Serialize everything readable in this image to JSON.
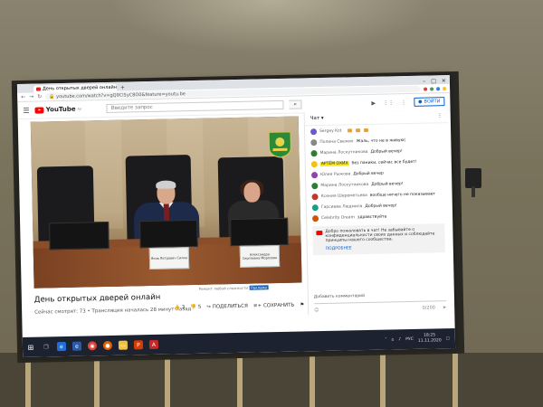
{
  "browser": {
    "tab_title": "День открытых дверей онлайн",
    "url": "youtube.com/watch?v=gQ9Cl5yC8O0&feature=youtu.be"
  },
  "youtube": {
    "logo_text": "YouTube",
    "logo_region": "RU",
    "search_placeholder": "Введите запрос",
    "signin_label": "ВОЙТИ"
  },
  "video": {
    "nameplate_left": "Яков Петрович Силин",
    "nameplate_right": "Александра Сергеевна Морозова",
    "watermark": "Ремонт любой сложности",
    "watermark_badge": "Реклама",
    "title": "День открытых дверей онлайн",
    "meta": "Сейчас смотрят: 73 • Трансляция началась 28 минут назад",
    "likes": "3",
    "dislikes": "5",
    "share_label": "ПОДЕЛИТЬСЯ",
    "save_label": "СОХРАНИТЬ"
  },
  "chat": {
    "header": "Чат",
    "messages": [
      {
        "author": "Sergey Kot",
        "text": "",
        "avatar_color": "#6a5acd",
        "highlight": false,
        "emoji": true
      },
      {
        "author": "Полина Свежих",
        "text": "Жаль, что не в живую(",
        "avatar_color": "#888888",
        "highlight": false,
        "emoji": false
      },
      {
        "author": "Марина Лоскутникова",
        "text": "Добрый вечер!",
        "avatar_color": "#2e7d32",
        "highlight": false,
        "emoji": false
      },
      {
        "author": "АРТЁМ ОХИХ",
        "text": "без паники, сейчас все будет!",
        "avatar_color": "#f1c40f",
        "highlight": true,
        "emoji": false
      },
      {
        "author": "Юлия Рыжова",
        "text": "Добрый вечер",
        "avatar_color": "#8e44ad",
        "highlight": false,
        "emoji": false
      },
      {
        "author": "Марина Лоскутникова",
        "text": "Добрый вечер!",
        "avatar_color": "#2e7d32",
        "highlight": false,
        "emoji": false
      },
      {
        "author": "Ксения Шереметьева",
        "text": "вообще ничего не показывает",
        "avatar_color": "#c0392b",
        "highlight": false,
        "emoji": false
      },
      {
        "author": "Гарсиева Людмила",
        "text": "Добрый вечер!",
        "avatar_color": "#16a085",
        "highlight": false,
        "emoji": false
      },
      {
        "author": "Celebrity Dream",
        "text": "здравствуйте",
        "avatar_color": "#d35400",
        "highlight": false,
        "emoji": false
      }
    ],
    "notice_text": "Добро пожаловать в чат! Не забывайте о конфиденциальности своих данных и соблюдайте принципы нашего сообщества.",
    "notice_more": "ПОДРОБНЕЕ",
    "input_placeholder": "Добавить комментарий",
    "char_count": "0/200"
  },
  "taskbar": {
    "lang": "РУС",
    "time": "18:25",
    "date": "11.11.2020"
  }
}
